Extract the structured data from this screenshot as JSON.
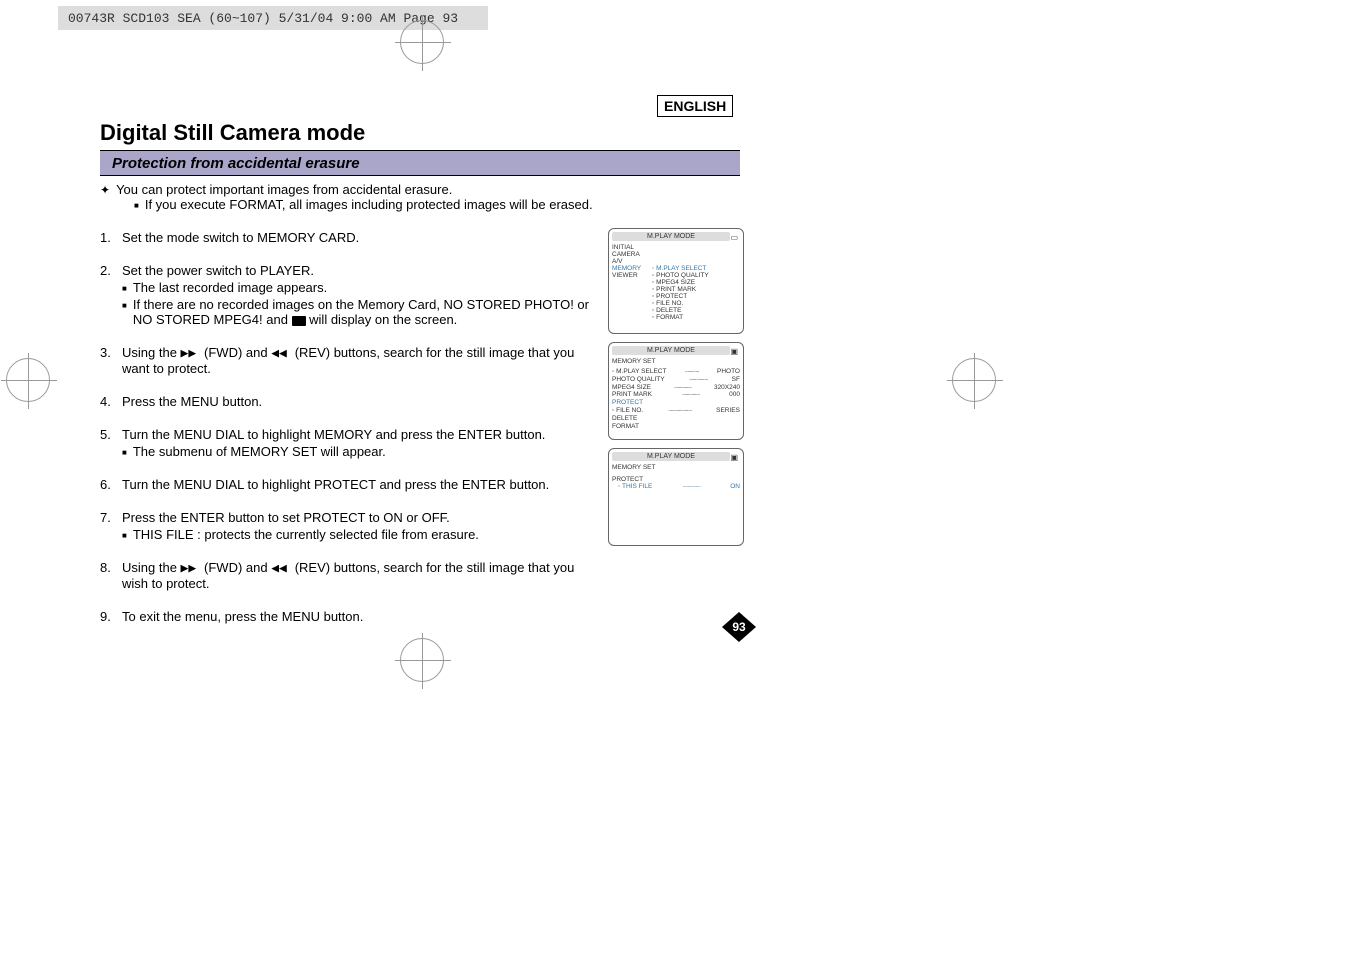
{
  "header": "00743R SCD103 SEA (60~107)  5/31/04 9:00 AM  Page 93",
  "english": "ENGLISH",
  "title": "Digital Still Camera mode",
  "section": "Protection from accidental erasure",
  "intro": {
    "line1": "You can protect important images from accidental erasure.",
    "line2": "If you execute FORMAT, all images including protected images will be erased."
  },
  "steps": {
    "s1": "Set the mode switch to MEMORY CARD.",
    "s2": "Set the power switch to PLAYER.",
    "s2a": "The last recorded image appears.",
    "s2b": "If there are no recorded images on the Memory Card, NO STORED PHOTO! or NO STORED MPEG4! and ",
    "s2b2": " will display on the screen.",
    "s3a": "Using the ",
    "s3b": "(FWD) and ",
    "s3c": "(REV) buttons, search for the still image that you want to protect.",
    "s4": "Press the MENU button.",
    "s5": "Turn the MENU DIAL to highlight MEMORY and press the ENTER button.",
    "s5a": "The submenu of MEMORY SET will appear.",
    "s6": "Turn the MENU DIAL to highlight PROTECT and press the ENTER button.",
    "s7": "Press the ENTER button to set PROTECT to ON or OFF.",
    "s7a": "THIS FILE : protects the currently selected file from erasure.",
    "s8a": "Using the ",
    "s8b": "(FWD) and ",
    "s8c": "(REV) buttons, search for the still image that you wish to protect.",
    "s9": "To exit the menu, press the MENU button."
  },
  "screen1": {
    "title": "M.PLAY  MODE",
    "left": [
      "INITIAL",
      "CAMERA",
      "A/V",
      "MEMORY",
      "VIEWER"
    ],
    "right": [
      "M.PLAY SELECT",
      "PHOTO QUALITY",
      "MPEG4 SIZE",
      "PRINT MARK",
      "PROTECT",
      "FILE NO.",
      "DELETE",
      "FORMAT"
    ]
  },
  "screen2": {
    "title": "M.PLAY  MODE",
    "head": "MEMORY SET",
    "rows": [
      {
        "l": "M.PLAY SELECT",
        "r": "PHOTO"
      },
      {
        "l": "PHOTO QUALITY",
        "r": "SF"
      },
      {
        "l": "MPEG4 SIZE",
        "r": "320X240"
      },
      {
        "l": "PRINT MARK",
        "r": "000"
      },
      {
        "l": "PROTECT",
        "r": ""
      },
      {
        "l": "FILE NO.",
        "r": "SERIES"
      },
      {
        "l": "DELETE",
        "r": ""
      },
      {
        "l": "FORMAT",
        "r": ""
      }
    ]
  },
  "screen3": {
    "title": "M.PLAY  MODE",
    "head": "MEMORY SET",
    "sub": "PROTECT",
    "row_l": "THIS FILE",
    "row_r": "ON"
  },
  "pagenum": "93"
}
